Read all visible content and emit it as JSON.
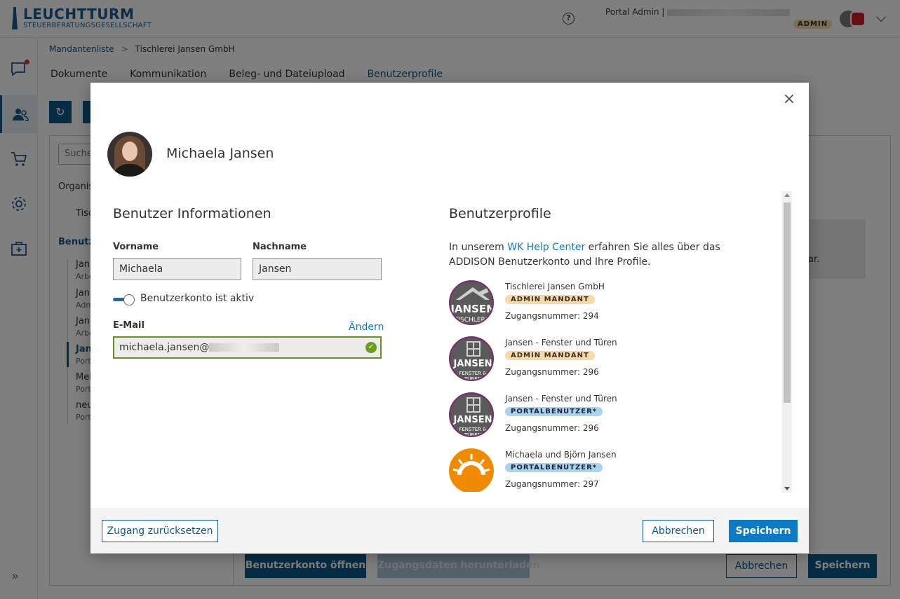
{
  "header": {
    "logo_name": "LEUCHTTURM",
    "logo_sub": "STEUERBERATUNGSGESELLSCHAFT",
    "user_label": "Portal Admin |",
    "role_badge": "ADMIN"
  },
  "breadcrumb": {
    "root": "Mandantenliste",
    "current": "Tischlerei Jansen GmbH"
  },
  "tabs": [
    "Dokumente",
    "Kommunikation",
    "Beleg- und Dateiupload",
    "Benutzerprofile"
  ],
  "background": {
    "search_placeholder": "Suche",
    "org_label": "Organis",
    "org_item": "Tisc",
    "users_label": "Benutze",
    "list": [
      {
        "name": "Jan",
        "sub": "Arbe"
      },
      {
        "name": "Jan",
        "sub": "Adm"
      },
      {
        "name": "Jan",
        "sub": "Arbe"
      },
      {
        "name": "Jan",
        "sub": "Porta"
      },
      {
        "name": "Mel",
        "sub": "Port"
      },
      {
        "name": "neu",
        "sub": "Port"
      }
    ],
    "info_text": "ar.",
    "footer": {
      "open_account": "Benutzerkonto öffnen",
      "download": "Zugangsdaten herunterladen",
      "cancel": "Abbrechen",
      "save": "Speichern"
    }
  },
  "modal": {
    "close": "×",
    "user_full_name": "Michaela Jansen",
    "info_title": "Benutzer Informationen",
    "firstname_label": "Vorname",
    "firstname_value": "Michaela",
    "lastname_label": "Nachname",
    "lastname_value": "Jansen",
    "active_label": "Benutzerkonto ist aktiv",
    "email_label": "E-Mail",
    "change_link": "Ändern",
    "email_value": "michaela.jansen@",
    "profiles_title": "Benutzerprofile",
    "intro_pre": "In unserem ",
    "intro_link": "WK Help Center",
    "intro_post": " erfahren Sie alles über das ADDISON Benutzerkonto und Ihre Profile.",
    "profiles": [
      {
        "company": "Tischlerei Jansen GmbH",
        "role": "ADMIN MANDANT",
        "number": "Zugangsnummer: 294",
        "logo_line1": "JANSEN",
        "logo_line2": "TISCHLEREI"
      },
      {
        "company": "Jansen - Fenster und Türen",
        "role": "ADMIN MANDANT",
        "number": "Zugangsnummer: 296",
        "logo_line1": "JANSEN",
        "logo_line2": "FENSTER & TÜREN"
      },
      {
        "company": "Jansen - Fenster und Türen",
        "role": "PORTALBENUTZER*",
        "number": "Zugangsnummer: 296",
        "logo_line1": "JANSEN",
        "logo_line2": "FENSTER & TÜREN"
      },
      {
        "company": "Michaela und Björn Jansen",
        "role": "PORTALBENUTZER*",
        "number": "Zugangsnummer: 297"
      }
    ],
    "reset_button": "Zugang zurücksetzen",
    "cancel_button": "Abbrechen",
    "save_button": "Speichern"
  },
  "colors": {
    "brand": "#1b5a8f",
    "link": "#0c7ac4",
    "admin_badge": "#f8d9a4",
    "portal_badge": "#a9d4ef",
    "success": "#6b9e1f"
  }
}
